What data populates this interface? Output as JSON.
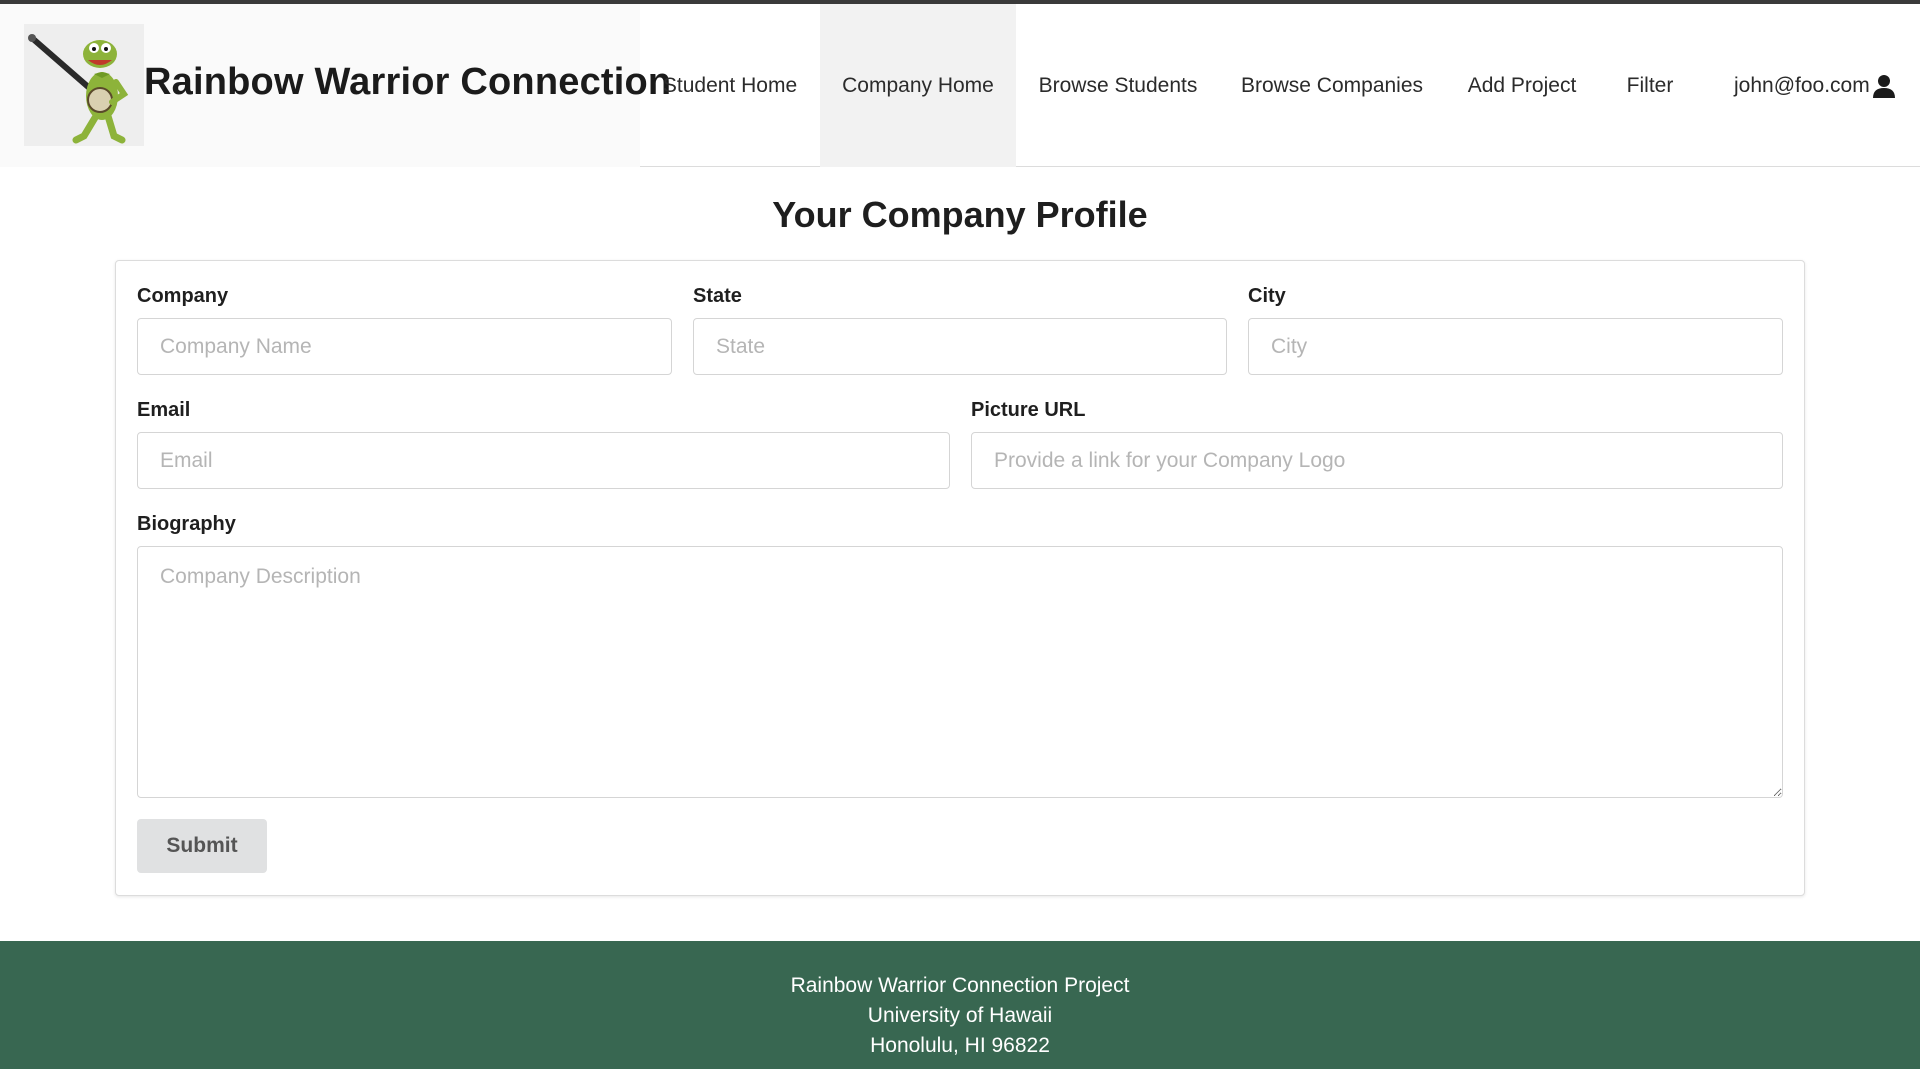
{
  "brand": {
    "title": "Rainbow Warrior Connection"
  },
  "nav": {
    "items": [
      {
        "label": "Student Home"
      },
      {
        "label": "Company Home"
      },
      {
        "label": "Browse Students"
      },
      {
        "label": "Browse Companies"
      },
      {
        "label": "Add Project"
      },
      {
        "label": "Filter"
      }
    ],
    "active": "Company Home",
    "user": "john@foo.com",
    "user_icon": "user-icon"
  },
  "page": {
    "title": "Your Company Profile"
  },
  "form": {
    "company": {
      "label": "Company",
      "placeholder": "Company Name",
      "value": ""
    },
    "state": {
      "label": "State",
      "placeholder": "State",
      "value": ""
    },
    "city": {
      "label": "City",
      "placeholder": "City",
      "value": ""
    },
    "email": {
      "label": "Email",
      "placeholder": "Email",
      "value": ""
    },
    "picture": {
      "label": "Picture URL",
      "placeholder": "Provide a link for your Company Logo",
      "value": ""
    },
    "biography": {
      "label": "Biography",
      "placeholder": "Company Description",
      "value": ""
    },
    "submit_label": "Submit"
  },
  "footer": {
    "lines": [
      "Rainbow Warrior Connection Project",
      "University of Hawaii",
      "Honolulu, HI 96822"
    ],
    "background_color": "#386751"
  }
}
